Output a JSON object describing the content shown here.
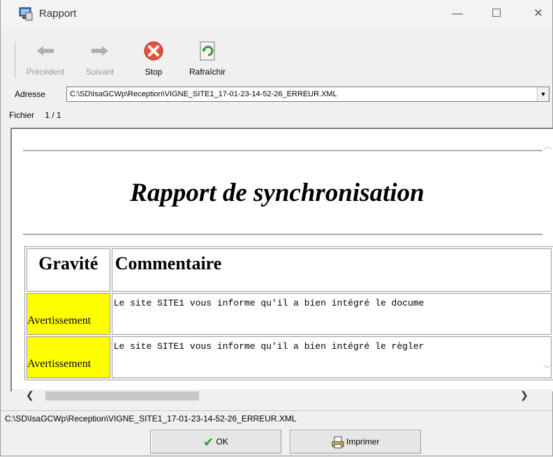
{
  "window": {
    "title": "Rapport",
    "controls": {
      "minimize": "—",
      "maximize": "☐",
      "close": "✕"
    }
  },
  "toolbar": {
    "previous_label": "Précédent",
    "next_label": "Suivant",
    "stop_label": "Stop",
    "refresh_label": "Rafraîchir"
  },
  "address": {
    "label": "Adresse",
    "value": "C:\\SD\\IsaGCWp\\Reception\\VIGNE_SITE1_17-01-23-14-52-26_ERREUR.XML"
  },
  "file_bar": {
    "label": "Fichier",
    "position": "1 / 1"
  },
  "report": {
    "title": "Rapport de synchronisation",
    "headers": {
      "severity": "Gravité",
      "comment": "Commentaire"
    },
    "rows": [
      {
        "severity": "Avertissement",
        "comment": "Le site SITE1 vous informe qu'il a bien intégré le docume"
      },
      {
        "severity": "Avertissement",
        "comment": "Le site SITE1 vous informe qu'il a bien intégré le règler"
      }
    ],
    "severity_color": "#ffff00"
  },
  "status": {
    "path": "C:\\SD\\IsaGCWp\\Reception\\VIGNE_SITE1_17-01-23-14-52-26_ERREUR.XML"
  },
  "buttons": {
    "ok_label": "OK",
    "print_label": "Imprimer"
  }
}
